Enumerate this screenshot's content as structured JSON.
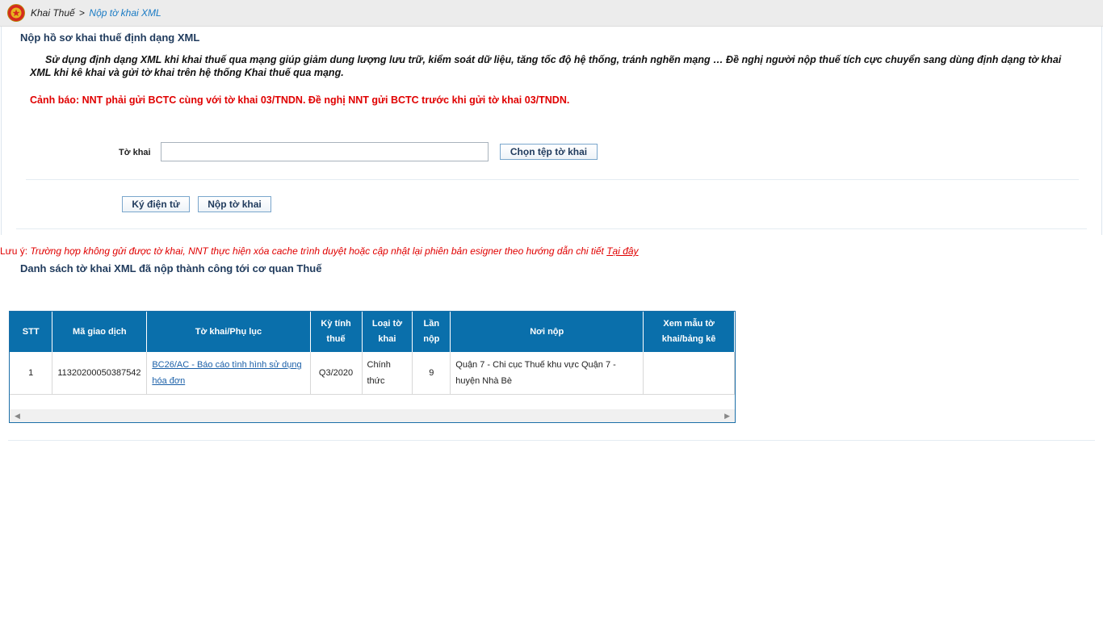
{
  "breadcrumb": {
    "parent": "Khai Thuế",
    "separator": ">",
    "current": "Nộp tờ khai XML"
  },
  "upload_section": {
    "title": "Nộp hồ sơ khai thuế định dạng XML",
    "intro": "Sử dụng định dạng XML khi khai thuế qua mạng giúp giảm dung lượng lưu trữ, kiểm soát dữ liệu, tăng tốc độ hệ thống, tránh nghẽn mạng … Đề nghị người nộp thuế tích cực chuyển sang dùng định dạng tờ khai XML khi kê khai và gửi tờ khai trên hệ thống Khai thuế qua mạng.",
    "warning": "Cảnh báo: NNT phải gửi BCTC cùng với tờ khai 03/TNDN. Đề nghị NNT gửi BCTC trước khi gửi tờ khai 03/TNDN.",
    "file_label": "Tờ khai",
    "file_value": "",
    "choose_button": "Chọn tệp tờ khai",
    "sign_button": "Ký điện tử",
    "submit_button": "Nộp tờ khai"
  },
  "note": {
    "prefix": "Lưu ý: ",
    "text": "Trường hợp không gửi được tờ khai, NNT thực hiện xóa cache trình duyệt hoặc cập nhật lại phiên bản esigner theo hướng dẫn chi tiết ",
    "link": "Tại đây"
  },
  "list_section": {
    "title": "Danh sách tờ khai XML đã nộp thành công tới cơ quan Thuế"
  },
  "table": {
    "headers": {
      "stt": "STT",
      "transaction_id": "Mã giao dịch",
      "form": "Tờ khai/Phụ lục",
      "period": "Kỳ tính thuế",
      "type": "Loại tờ khai",
      "count": "Lần nộp",
      "office": "Nơi nộp",
      "view": "Xem mẫu tờ khai/bảng kê"
    },
    "rows": [
      {
        "stt": "1",
        "transaction_id": "11320200050387542",
        "form": "BC26/AC - Báo cáo tình hình sử dụng hóa đơn",
        "period": "Q3/2020",
        "type": "Chính thức",
        "count": "9",
        "office": "Quận 7 - Chi cục Thuế khu vực Quận 7 - huyện Nhà Bè",
        "view": ""
      }
    ]
  },
  "colors": {
    "table_header": "#0a6fab",
    "warning_red": "#e00000",
    "title_navy": "#1f3a5c",
    "breadcrumb_link": "#1a7bc4"
  },
  "icons": {
    "emblem": "national-emblem-icon",
    "scroll_left": "scroll-left-icon",
    "scroll_right": "scroll-right-icon"
  }
}
